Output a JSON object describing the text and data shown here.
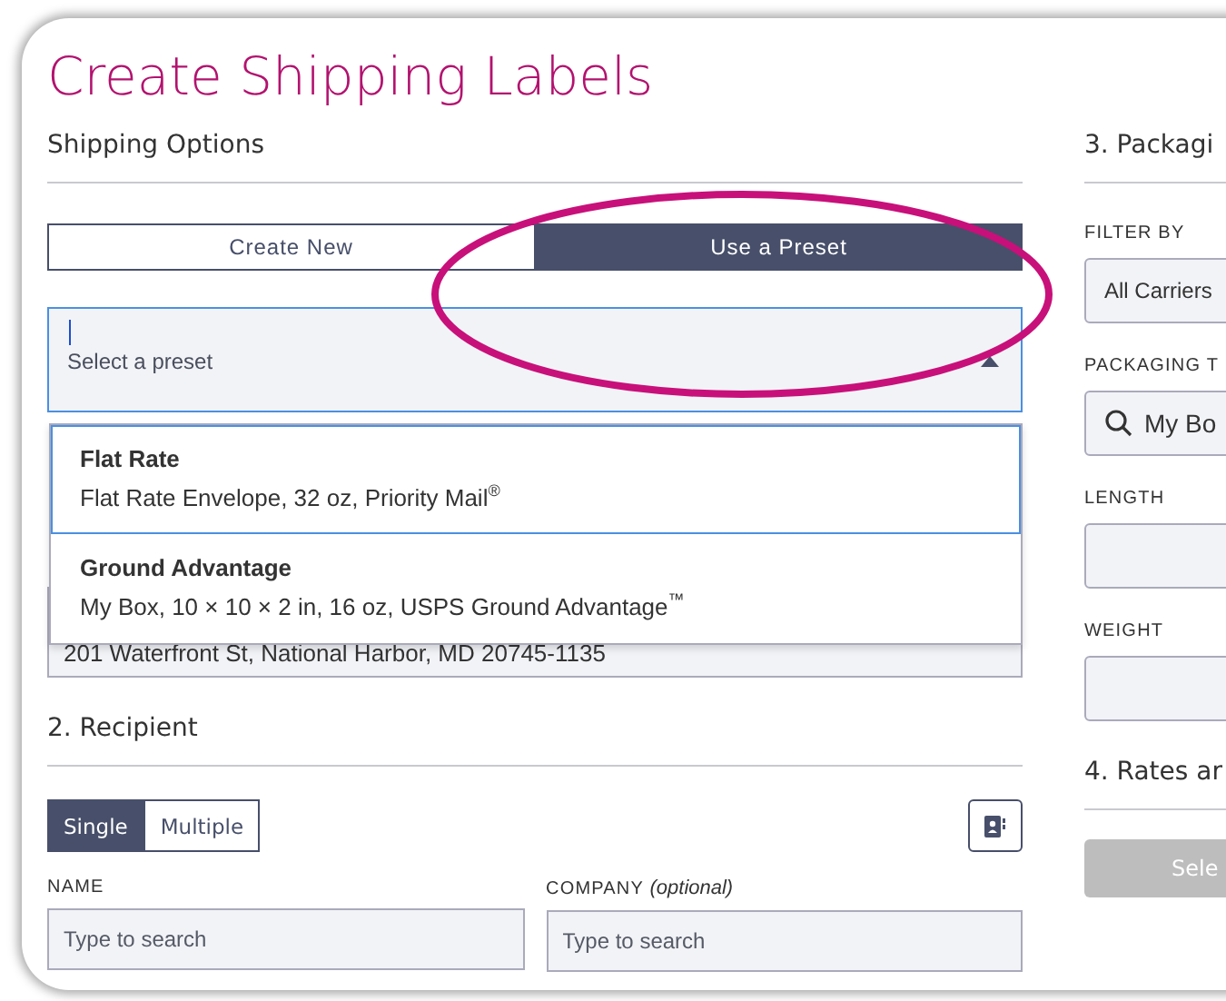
{
  "title": "Create Shipping Labels",
  "shipping_options": {
    "heading": "Shipping Options",
    "toggle": [
      {
        "label": "Create New",
        "selected": false
      },
      {
        "label": "Use a Preset",
        "selected": true
      }
    ],
    "preset_select": {
      "placeholder": "Select a preset",
      "expanded": true
    },
    "presets": [
      {
        "name": "Flat Rate",
        "detail": "Flat Rate Envelope, 32 oz, Priority Mail$^{®}$",
        "highlighted": true
      },
      {
        "name": "Ground Advantage",
        "detail": "My Box, 10 × 10 × 2 in, 16 oz, USPS Ground Advantage$^{™}$",
        "highlighted": false
      }
    ],
    "address": "201 Waterfront St, National Harbor, MD 20745-1135"
  },
  "recipient": {
    "heading": "2. Recipient",
    "toggle": [
      {
        "label": "Single",
        "selected": true
      },
      {
        "label": "Multiple",
        "selected": false
      }
    ],
    "fields": [
      {
        "label": "NAME",
        "placeholder": "Type to search"
      },
      {
        "label": "COMPANY",
        "note": "(optional)",
        "placeholder": "Type to search"
      }
    ]
  },
  "packaging": {
    "heading": "3. Packagi",
    "fields": [
      {
        "kind": "select",
        "label": "FILTER BY",
        "value": "All Carriers"
      },
      {
        "kind": "search",
        "label": "PACKAGING T",
        "value": "My Bo"
      },
      {
        "kind": "input",
        "label": "LENGTH"
      },
      {
        "kind": "input",
        "label": "WEIGHT"
      }
    ]
  },
  "rates": {
    "heading": "4. Rates ar",
    "button": "Sele"
  }
}
